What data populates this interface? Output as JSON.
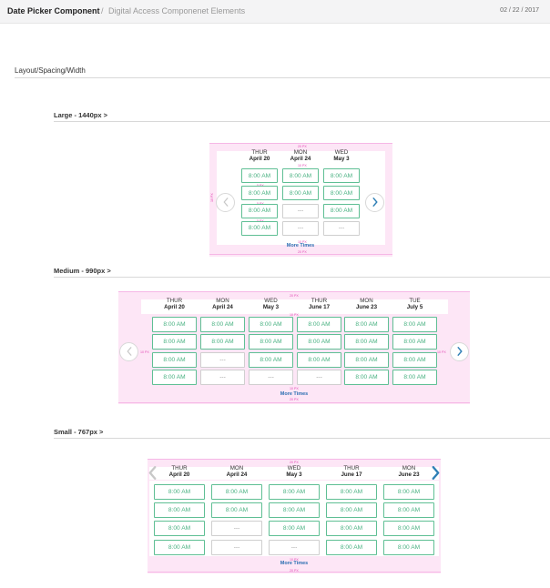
{
  "header": {
    "title": "Date Picker Component",
    "separator": "/",
    "subtitle": "Digital Access Componenet Elements",
    "date": "02 / 22 / 2017"
  },
  "section_title": "Layout/Spacing/Width",
  "spacing_notes": {
    "px20": "20 PX",
    "px10": "10 PX",
    "px5": "5 PX"
  },
  "large": {
    "title": "Large - 1440px >",
    "days": [
      {
        "dow": "THUR",
        "date": "April 20"
      },
      {
        "dow": "MON",
        "date": "April 24"
      },
      {
        "dow": "WED",
        "date": "May 3"
      }
    ],
    "slots": [
      [
        "8:00 AM",
        "8:00 AM",
        "8:00 AM",
        "8:00 AM"
      ],
      [
        "8:00 AM",
        "8:00 AM",
        "---",
        "---"
      ],
      [
        "8:00 AM",
        "8:00 AM",
        "8:00 AM",
        "---"
      ]
    ],
    "more": "More Times"
  },
  "medium": {
    "title": "Medium - 990px >",
    "days": [
      {
        "dow": "THUR",
        "date": "April 20"
      },
      {
        "dow": "MON",
        "date": "April 24"
      },
      {
        "dow": "WED",
        "date": "May 3"
      },
      {
        "dow": "THUR",
        "date": "June 17"
      },
      {
        "dow": "MON",
        "date": "June 23"
      },
      {
        "dow": "TUE",
        "date": "July 5"
      }
    ],
    "slots": [
      [
        "8:00 AM",
        "8:00 AM",
        "8:00 AM",
        "8:00 AM"
      ],
      [
        "8:00 AM",
        "8:00 AM",
        "---",
        "---"
      ],
      [
        "8:00 AM",
        "8:00 AM",
        "8:00 AM",
        "---"
      ],
      [
        "8:00 AM",
        "8:00 AM",
        "8:00 AM",
        "---"
      ],
      [
        "8:00 AM",
        "8:00 AM",
        "8:00 AM",
        "8:00 AM"
      ],
      [
        "8:00 AM",
        "8:00 AM",
        "8:00 AM",
        "8:00 AM"
      ]
    ],
    "more": "More Times"
  },
  "small": {
    "title": "Small - 767px >",
    "days": [
      {
        "dow": "THUR",
        "date": "April 20"
      },
      {
        "dow": "MON",
        "date": "April 24"
      },
      {
        "dow": "WED",
        "date": "May 3"
      },
      {
        "dow": "THUR",
        "date": "June 17"
      },
      {
        "dow": "MON",
        "date": "June 23"
      }
    ],
    "slots": [
      [
        "8:00 AM",
        "8:00 AM",
        "8:00 AM",
        "8:00 AM"
      ],
      [
        "8:00 AM",
        "8:00 AM",
        "---",
        "---"
      ],
      [
        "8:00 AM",
        "8:00 AM",
        "8:00 AM",
        "---"
      ],
      [
        "8:00 AM",
        "8:00 AM",
        "8:00 AM",
        "8:00 AM"
      ],
      [
        "8:00 AM",
        "8:00 AM",
        "8:00 AM",
        "8:00 AM"
      ]
    ],
    "more": "More Times"
  },
  "icons": {
    "prev": "chevron-left-icon",
    "next": "chevron-right-icon"
  },
  "colors": {
    "slot_border": "#5fbf94",
    "slot_text": "#48b181",
    "spacing_fill": "#fde6f6",
    "spacing_line": "#f6b7e6",
    "spacing_note": "#e34bb6",
    "more_link": "#2c6fb2",
    "arrow_active": "#2f7fb6",
    "arrow_inactive": "#c8c8c8"
  }
}
